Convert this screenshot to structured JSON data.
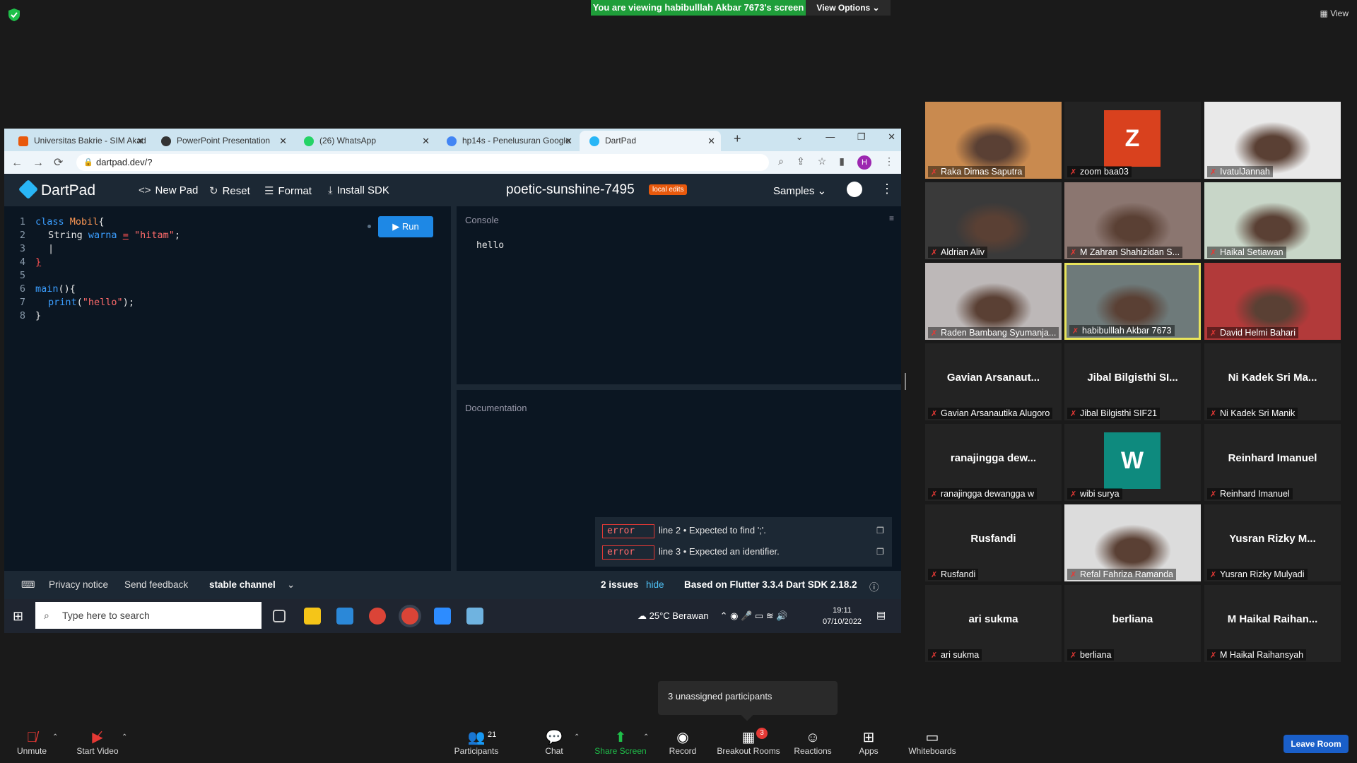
{
  "zoom_top": {
    "viewing_banner": "You are viewing habibulllah Akbar 7673's screen",
    "view_options": "View Options ⌄",
    "view_label": "View"
  },
  "browser": {
    "tabs": [
      {
        "label": "Universitas Bakrie - SIM Akad",
        "icon_color": "#e8590c"
      },
      {
        "label": "PowerPoint Presentation",
        "icon_color": "#333333"
      },
      {
        "label": "(26) WhatsApp",
        "icon_color": "#25d366"
      },
      {
        "label": "hp14s - Penelusuran Google",
        "icon_color": "#4285f4"
      },
      {
        "label": "DartPad",
        "icon_color": "#29b6f6"
      }
    ],
    "url": "dartpad.dev/?",
    "profile_letter": "H"
  },
  "dartpad": {
    "logo": "DartPad",
    "new_pad": "New Pad",
    "reset": "Reset",
    "format": "Format",
    "install_sdk": "Install SDK",
    "title": "poetic-sunshine-7495",
    "local_edits": "local edits",
    "samples": "Samples",
    "run": "Run",
    "console_label": "Console",
    "console_output": "hello",
    "documentation_label": "Documentation",
    "line_numbers": [
      "1",
      "2",
      "3",
      "4",
      "5",
      "6",
      "7",
      "8"
    ],
    "code": {
      "l1_kw": "class",
      "l1_name": "Mobil",
      "l1_rest": "{",
      "l2_type": "String",
      "l2_var": "warna",
      "l2_eq": "=",
      "l2_str": "\"hitam\"",
      "l2_end": ";",
      "l4": "}",
      "l6_kw": "main",
      "l6_rest": "(){",
      "l7_fn": "print",
      "l7_open": "(",
      "l7_str": "\"hello\"",
      "l7_close": ");",
      "l8": "}"
    },
    "issues": [
      {
        "tag": "error",
        "message": "line 2 • Expected to find ';'."
      },
      {
        "tag": "error",
        "message": "line 3 • Expected an identifier."
      }
    ],
    "footer": {
      "privacy": "Privacy notice",
      "feedback": "Send feedback",
      "channel": "stable channel",
      "issues_count": "2 issues",
      "hide": "hide",
      "sdk": "Based on Flutter 3.3.4 Dart SDK 2.18.2"
    }
  },
  "taskbar": {
    "search_placeholder": "Type here to search",
    "weather": "25°C  Berawan",
    "time": "19:11",
    "date": "07/10/2022"
  },
  "participants_tiles": [
    {
      "name": "Raka Dimas Saputra",
      "kind": "video",
      "bg": "#c98a4f"
    },
    {
      "name": "zoom baa03",
      "kind": "letter",
      "letter": "Z",
      "letter_bg": "#d9411e"
    },
    {
      "name": "IvatulJannah",
      "kind": "video",
      "bg": "#e9e9e9"
    },
    {
      "name": "Aldrian Aliv",
      "kind": "video",
      "bg": "#3a3a3a"
    },
    {
      "name": "M Zahran Shahizidan S...",
      "kind": "video",
      "bg": "#8b7670"
    },
    {
      "name": "Haikal Setiawan",
      "kind": "video",
      "bg": "#c8d6c8"
    },
    {
      "name": "Raden Bambang Syumanja...",
      "kind": "video",
      "bg": "#bdb8b8"
    },
    {
      "name": "habibulllah Akbar 7673",
      "kind": "video",
      "bg": "#6e7a7a",
      "highlight": true
    },
    {
      "name": "David Helmi Bahari",
      "kind": "video",
      "bg": "#b23a3a"
    },
    {
      "name": "Gavian Arsanautika Alugoro",
      "kind": "name",
      "display": "Gavian  Arsanaut..."
    },
    {
      "name": "Jibal Bilgisthi SIF21",
      "kind": "name",
      "display": "Jibal  Bilgisthi  SI..."
    },
    {
      "name": "Ni Kadek Sri Manik",
      "kind": "name",
      "display": "Ni  Kadek  Sri  Ma..."
    },
    {
      "name": "ranajingga dewangga w",
      "kind": "name",
      "display": "ranajingga  dew..."
    },
    {
      "name": "wibi surya",
      "kind": "letter",
      "letter": "W",
      "letter_bg": "#0e8a7e"
    },
    {
      "name": "Reinhard Imanuel",
      "kind": "name",
      "display": "Reinhard  Imanuel"
    },
    {
      "name": "Rusfandi",
      "kind": "name",
      "display": "Rusfandi"
    },
    {
      "name": "Refal Fahriza Ramanda",
      "kind": "video",
      "bg": "#dcdcdc"
    },
    {
      "name": "Yusran Rizky Mulyadi",
      "kind": "name",
      "display": "Yusran  Rizky  M..."
    },
    {
      "name": "ari sukma",
      "kind": "name",
      "display": "ari  sukma"
    },
    {
      "name": "berliana",
      "kind": "name",
      "display": "berliana"
    },
    {
      "name": "M Haikal Raihansyah",
      "kind": "name",
      "display": "M  Haikal  Raihan..."
    }
  ],
  "unassigned": "3 unassigned participants",
  "toolbar": {
    "unmute": "Unmute",
    "start_video": "Start Video",
    "participants": "Participants",
    "participants_count": "21",
    "chat": "Chat",
    "share_screen": "Share Screen",
    "record": "Record",
    "breakout_rooms": "Breakout Rooms",
    "breakout_badge": "3",
    "reactions": "Reactions",
    "apps": "Apps",
    "whiteboards": "Whiteboards",
    "leave": "Leave Room"
  }
}
